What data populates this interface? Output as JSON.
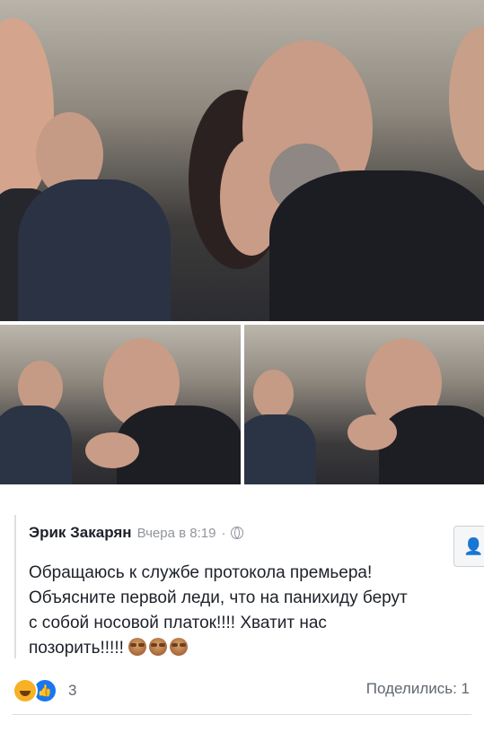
{
  "post": {
    "author": "Эрик Закарян",
    "time": "Вчера в 8:19",
    "separator": "·",
    "text_lines": [
      "Обращаюсь к службе протокола премьера!",
      "Объясните первой леди, что на панихиду берут",
      "с собой носовой платок!!!! Хватит нас",
      "позорить!!!!!"
    ],
    "emoji_count": 3
  },
  "reactions": {
    "count": "3",
    "icons": [
      "laugh-icon",
      "like-icon"
    ]
  },
  "shares": "Поделились: 1",
  "colors": {
    "text": "#1d2129",
    "meta": "#90949c",
    "like_blue": "#1877f2",
    "haha_yellow": "#f7b125"
  }
}
